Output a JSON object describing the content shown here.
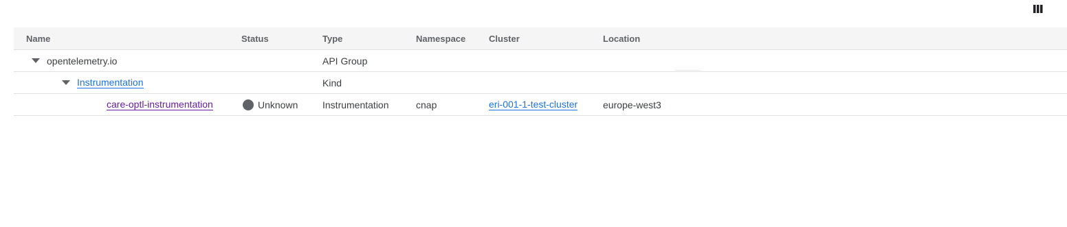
{
  "toolbar": {
    "column_toggle_icon": "column-display-icon"
  },
  "table": {
    "headers": {
      "name": "Name",
      "status": "Status",
      "type": "Type",
      "namespace": "Namespace",
      "cluster": "Cluster",
      "location": "Location"
    },
    "rows": [
      {
        "name": "opentelemetry.io",
        "type": "API Group",
        "expanded": true
      },
      {
        "name": "Instrumentation",
        "type": "Kind",
        "expanded": true
      },
      {
        "name": "care-optl-instrumentation",
        "status": "Unknown",
        "type": "Instrumentation",
        "namespace": "cnap",
        "cluster": "eri-001-1-test-cluster",
        "location": "europe-west3"
      }
    ]
  },
  "colors": {
    "link": "#1a73e8",
    "visited_link": "#681da8",
    "status_unknown": "#5f6368",
    "header_bg": "#f5f5f5"
  }
}
